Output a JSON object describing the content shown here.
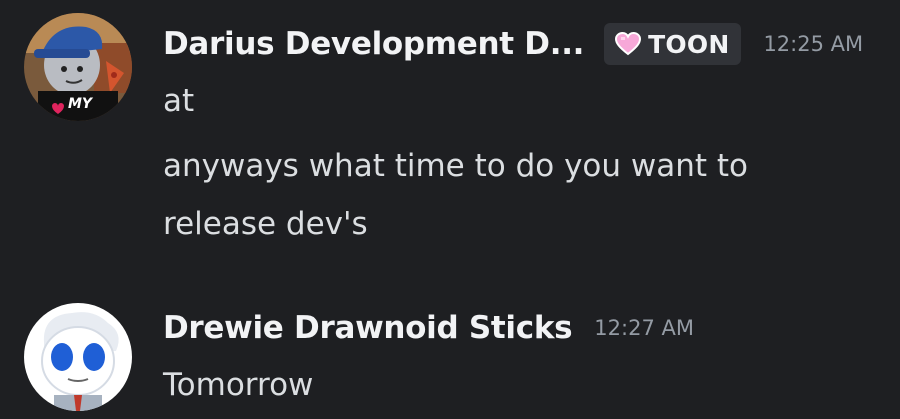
{
  "messages": [
    {
      "author": "Darius Development D...",
      "tag": "TOON",
      "tag_icon": "pink-heart-icon",
      "timestamp": "12:25 AM",
      "lines": [
        "at",
        "anyways what time to do you want to",
        "release dev's"
      ],
      "avatar_text": "MY"
    },
    {
      "author": "Drewie Drawnoid Sticks",
      "timestamp": "12:27 AM",
      "lines": [
        "Tomorrow"
      ]
    }
  ],
  "colors": {
    "background": "#1e1f22",
    "username": "#f2f3f5",
    "message_text": "#dbdee1",
    "timestamp": "#949ba4",
    "tag_bg": "#313338",
    "heart": "#f7a8d8"
  }
}
